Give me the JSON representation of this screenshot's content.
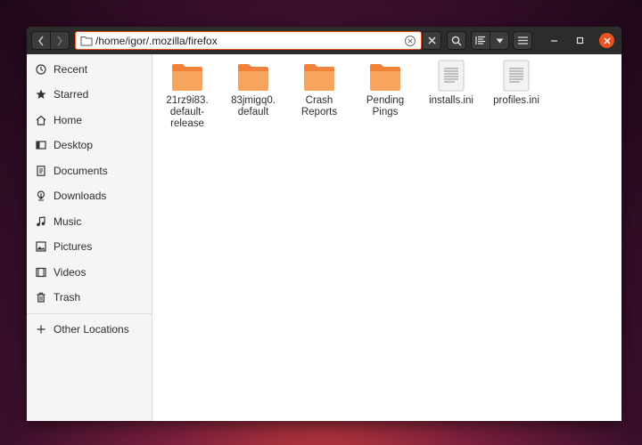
{
  "location": {
    "path": "/home/igor/.mozilla/firefox"
  },
  "sidebar": {
    "items": [
      {
        "label": "Recent",
        "icon": "clock-icon"
      },
      {
        "label": "Starred",
        "icon": "star-icon"
      },
      {
        "label": "Home",
        "icon": "home-icon"
      },
      {
        "label": "Desktop",
        "icon": "desktop-icon"
      },
      {
        "label": "Documents",
        "icon": "document-icon"
      },
      {
        "label": "Downloads",
        "icon": "download-icon"
      },
      {
        "label": "Music",
        "icon": "music-icon"
      },
      {
        "label": "Pictures",
        "icon": "picture-icon"
      },
      {
        "label": "Videos",
        "icon": "video-icon"
      },
      {
        "label": "Trash",
        "icon": "trash-icon"
      }
    ],
    "other": {
      "label": "Other Locations",
      "icon": "plus-icon"
    }
  },
  "files": [
    {
      "name": "21rz9i83.\ndefault-\nrelease",
      "type": "folder"
    },
    {
      "name": "83jmigq0.\ndefault",
      "type": "folder"
    },
    {
      "name": "Crash\nReports",
      "type": "folder"
    },
    {
      "name": "Pending\nPings",
      "type": "folder"
    },
    {
      "name": "installs.ini",
      "type": "text-file"
    },
    {
      "name": "profiles.ini",
      "type": "text-file"
    }
  ],
  "colors": {
    "accent": "#e95420",
    "folder": "#f0823a",
    "folder_light": "#f7a45f",
    "headerbar": "#2c2c2c"
  }
}
